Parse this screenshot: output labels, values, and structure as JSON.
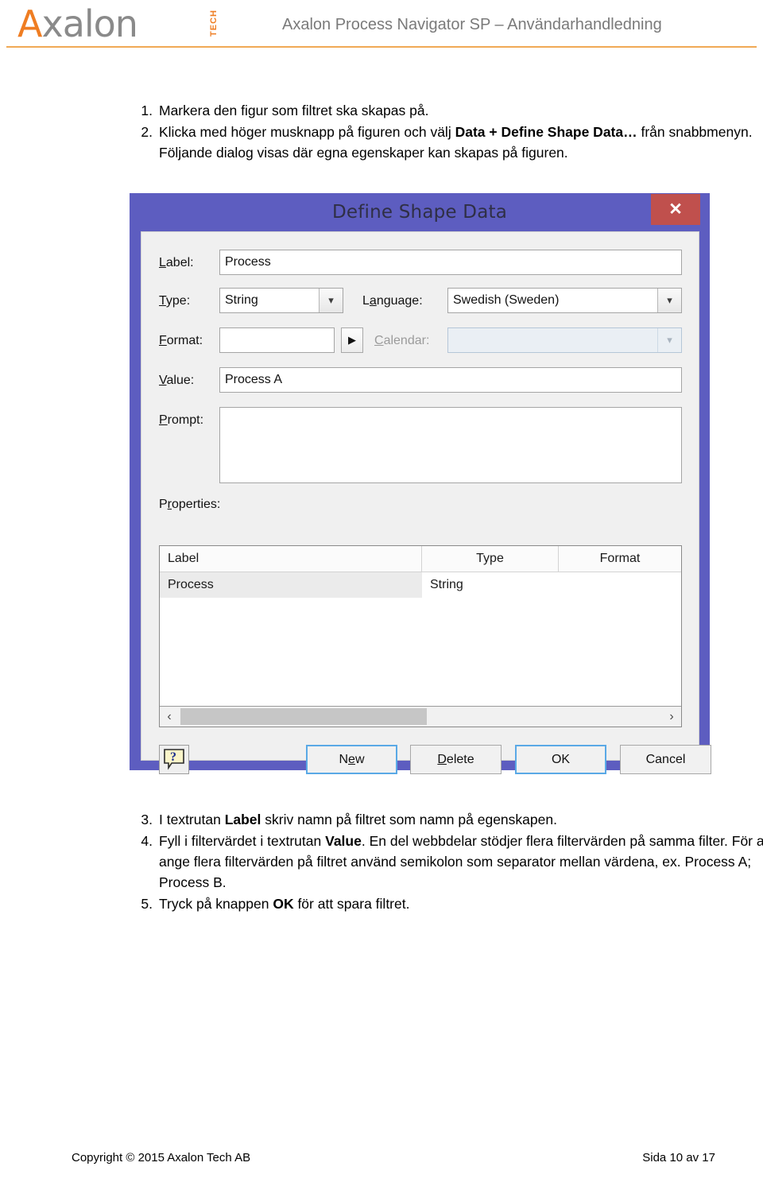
{
  "header": {
    "logo_a": "A",
    "logo_rest": "xalon",
    "logo_tech": "TECH",
    "title": "Axalon Process Navigator SP – Användarhandledning",
    "rule_color": "#f0a955"
  },
  "steps_top": [
    {
      "num": "1.",
      "parts": [
        {
          "text": "Markera den figur som filtret ska skapas på.",
          "bold": false
        }
      ]
    },
    {
      "num": "2.",
      "parts": [
        {
          "text": "Klicka med höger musknapp på figuren och välj ",
          "bold": false
        },
        {
          "text": "Data + Define Shape Data…",
          "bold": true
        },
        {
          "text": " från snabbmenyn. Följande dialog visas där egna egenskaper kan skapas på figuren.",
          "bold": false
        }
      ]
    }
  ],
  "steps_bottom": [
    {
      "num": "3.",
      "parts": [
        {
          "text": "I textrutan ",
          "bold": false
        },
        {
          "text": "Label",
          "bold": true
        },
        {
          "text": " skriv namn på filtret som namn på egenskapen.",
          "bold": false
        }
      ]
    },
    {
      "num": "4.",
      "parts": [
        {
          "text": "Fyll i filtervärdet i textrutan ",
          "bold": false
        },
        {
          "text": "Value",
          "bold": true
        },
        {
          "text": ". En del webbdelar stödjer flera filtervärden på samma filter. För att ange flera filtervärden på filtret använd semikolon som separator mellan värdena, ex. Process A; Process B.",
          "bold": false
        }
      ]
    },
    {
      "num": "5.",
      "parts": [
        {
          "text": "Tryck på knappen ",
          "bold": false
        },
        {
          "text": "OK",
          "bold": true
        },
        {
          "text": " för att spara filtret.",
          "bold": false
        }
      ]
    }
  ],
  "dialog": {
    "title": "Define Shape Data",
    "titlebar_color": "#5d5dc0",
    "close_label": "✕",
    "close_color": "#c0504d",
    "fields": {
      "label": {
        "caption": "Label:",
        "value": "Process"
      },
      "type": {
        "caption": "Type:",
        "value": "String"
      },
      "language": {
        "caption": "Language:",
        "value": "Swedish (Sweden)"
      },
      "format": {
        "caption": "Format:",
        "value": ""
      },
      "calendar": {
        "caption": "Calendar:",
        "value": "",
        "disabled": true
      },
      "value": {
        "caption": "Value:",
        "value": "Process A"
      },
      "prompt": {
        "caption": "Prompt:",
        "value": ""
      },
      "properties_caption": "Properties:"
    },
    "grid": {
      "columns": [
        "Label",
        "Type",
        "Format"
      ],
      "rows": [
        {
          "label": "Process",
          "type": "String",
          "format": ""
        }
      ]
    },
    "scrollbar": {
      "left_arrow": "‹",
      "right_arrow": "›"
    },
    "buttons": {
      "help": "?",
      "new": {
        "label": "New",
        "accel_index": 2,
        "focused": true
      },
      "delete": {
        "label": "Delete",
        "accel_index": 1,
        "focused": false
      },
      "ok": {
        "label": "OK",
        "focused": true
      },
      "cancel": {
        "label": "Cancel",
        "focused": false
      }
    },
    "accent_focus_color": "#5aa9e6"
  },
  "footer": {
    "left": "Copyright © 2015 Axalon Tech AB",
    "right": "Sida 10 av 17"
  }
}
